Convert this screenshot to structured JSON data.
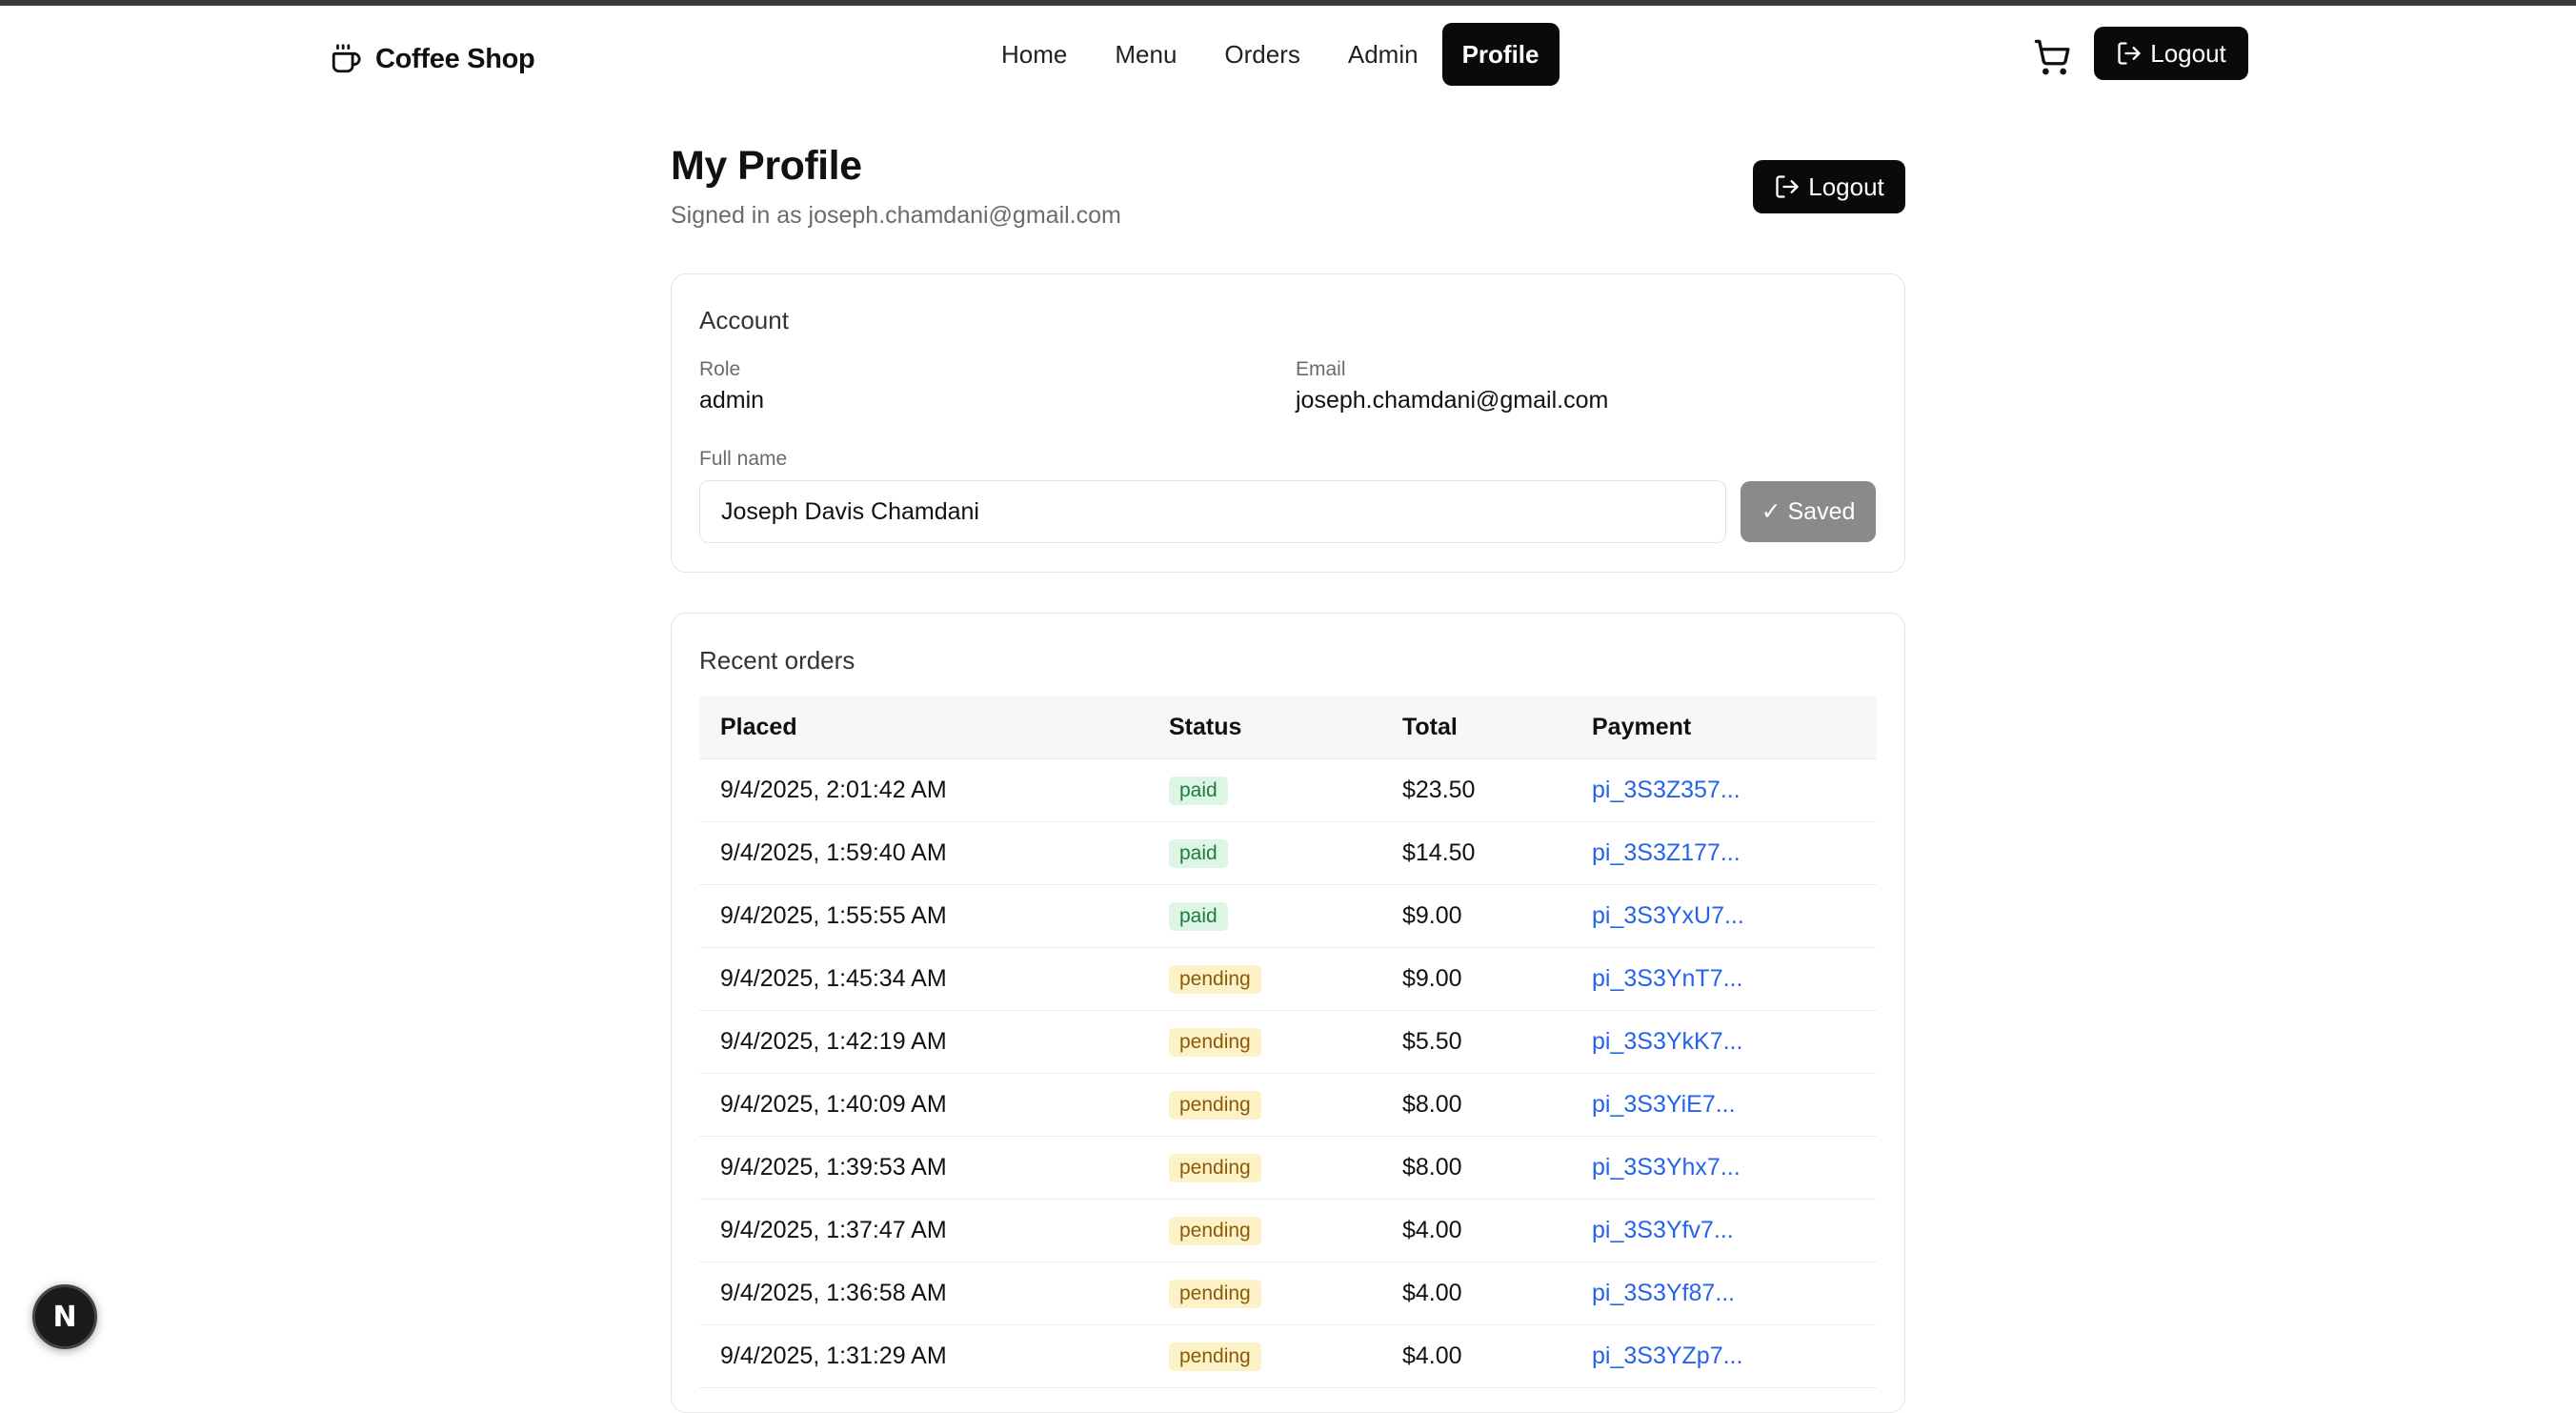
{
  "header": {
    "brand": "Coffee Shop",
    "nav": [
      "Home",
      "Menu",
      "Orders",
      "Admin",
      "Profile"
    ],
    "active_nav": "Profile",
    "logout_label": "Logout"
  },
  "profile": {
    "title": "My Profile",
    "signed_in_text": "Signed in as joseph.chamdani@gmail.com",
    "logout_label": "Logout"
  },
  "account": {
    "title": "Account",
    "role_label": "Role",
    "role_value": "admin",
    "email_label": "Email",
    "email_value": "joseph.chamdani@gmail.com",
    "full_name_label": "Full name",
    "full_name_value": "Joseph Davis Chamdani",
    "saved_label": "✓ Saved"
  },
  "orders": {
    "title": "Recent orders",
    "columns": [
      "Placed",
      "Status",
      "Total",
      "Payment"
    ],
    "rows": [
      {
        "placed": "9/4/2025, 2:01:42 AM",
        "status": "paid",
        "total": "$23.50",
        "payment": "pi_3S3Z357..."
      },
      {
        "placed": "9/4/2025, 1:59:40 AM",
        "status": "paid",
        "total": "$14.50",
        "payment": "pi_3S3Z177..."
      },
      {
        "placed": "9/4/2025, 1:55:55 AM",
        "status": "paid",
        "total": "$9.00",
        "payment": "pi_3S3YxU7..."
      },
      {
        "placed": "9/4/2025, 1:45:34 AM",
        "status": "pending",
        "total": "$9.00",
        "payment": "pi_3S3YnT7..."
      },
      {
        "placed": "9/4/2025, 1:42:19 AM",
        "status": "pending",
        "total": "$5.50",
        "payment": "pi_3S3YkK7..."
      },
      {
        "placed": "9/4/2025, 1:40:09 AM",
        "status": "pending",
        "total": "$8.00",
        "payment": "pi_3S3YiE7..."
      },
      {
        "placed": "9/4/2025, 1:39:53 AM",
        "status": "pending",
        "total": "$8.00",
        "payment": "pi_3S3Yhx7..."
      },
      {
        "placed": "9/4/2025, 1:37:47 AM",
        "status": "pending",
        "total": "$4.00",
        "payment": "pi_3S3Yfv7..."
      },
      {
        "placed": "9/4/2025, 1:36:58 AM",
        "status": "pending",
        "total": "$4.00",
        "payment": "pi_3S3Yf87..."
      },
      {
        "placed": "9/4/2025, 1:31:29 AM",
        "status": "pending",
        "total": "$4.00",
        "payment": "pi_3S3YZp7..."
      }
    ]
  },
  "dev_badge": "N",
  "icons": {
    "brand": "coffee-cup-icon",
    "cart": "shopping-cart-icon",
    "logout": "logout-icon"
  },
  "colors": {
    "primary": "#0a0a0a",
    "link": "#2563eb",
    "paid_bg": "#dcf5e4",
    "paid_text": "#1f7a3e",
    "pending_bg": "#fdf1c7",
    "pending_text": "#8a5a08",
    "saved_bg": "#8a8a8a"
  }
}
